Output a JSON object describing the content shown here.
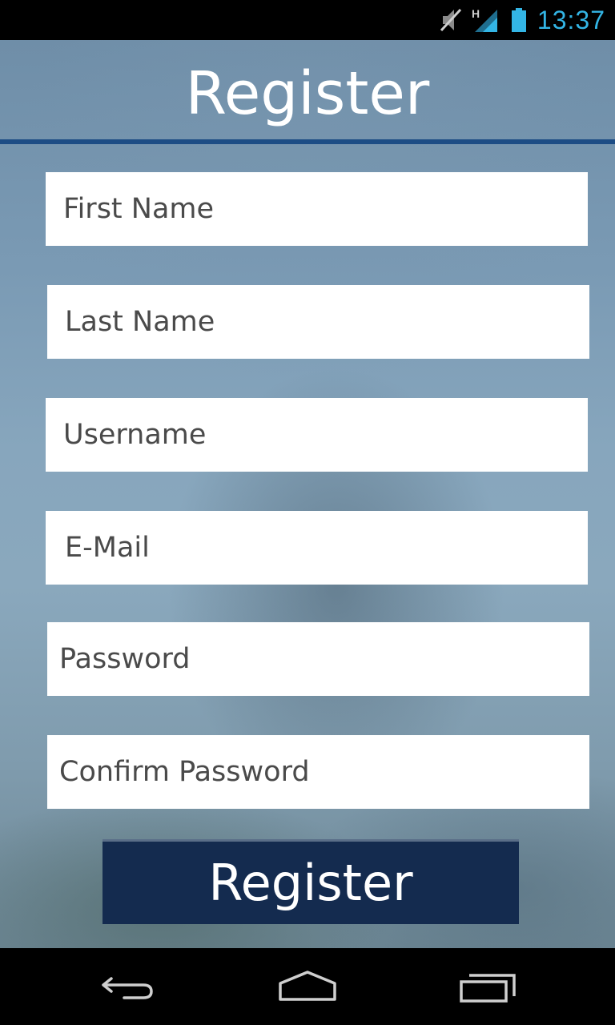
{
  "status_bar": {
    "time": "13:37",
    "network_type": "H",
    "icons": [
      "mute-icon",
      "signal-icon",
      "battery-icon"
    ],
    "accent_color": "#33b5e5"
  },
  "header": {
    "title": "Register",
    "rule_color": "#1d4d85"
  },
  "form": {
    "fields": [
      {
        "placeholder": "First Name"
      },
      {
        "placeholder": "Last Name"
      },
      {
        "placeholder": "Username"
      },
      {
        "placeholder": "E-Mail"
      },
      {
        "placeholder": "Password"
      },
      {
        "placeholder": "Confirm Password"
      }
    ],
    "submit_label": "Register",
    "submit_color": "#142b4f"
  },
  "nav_bar": {
    "icons": [
      "back-icon",
      "home-icon",
      "recent-apps-icon"
    ]
  }
}
